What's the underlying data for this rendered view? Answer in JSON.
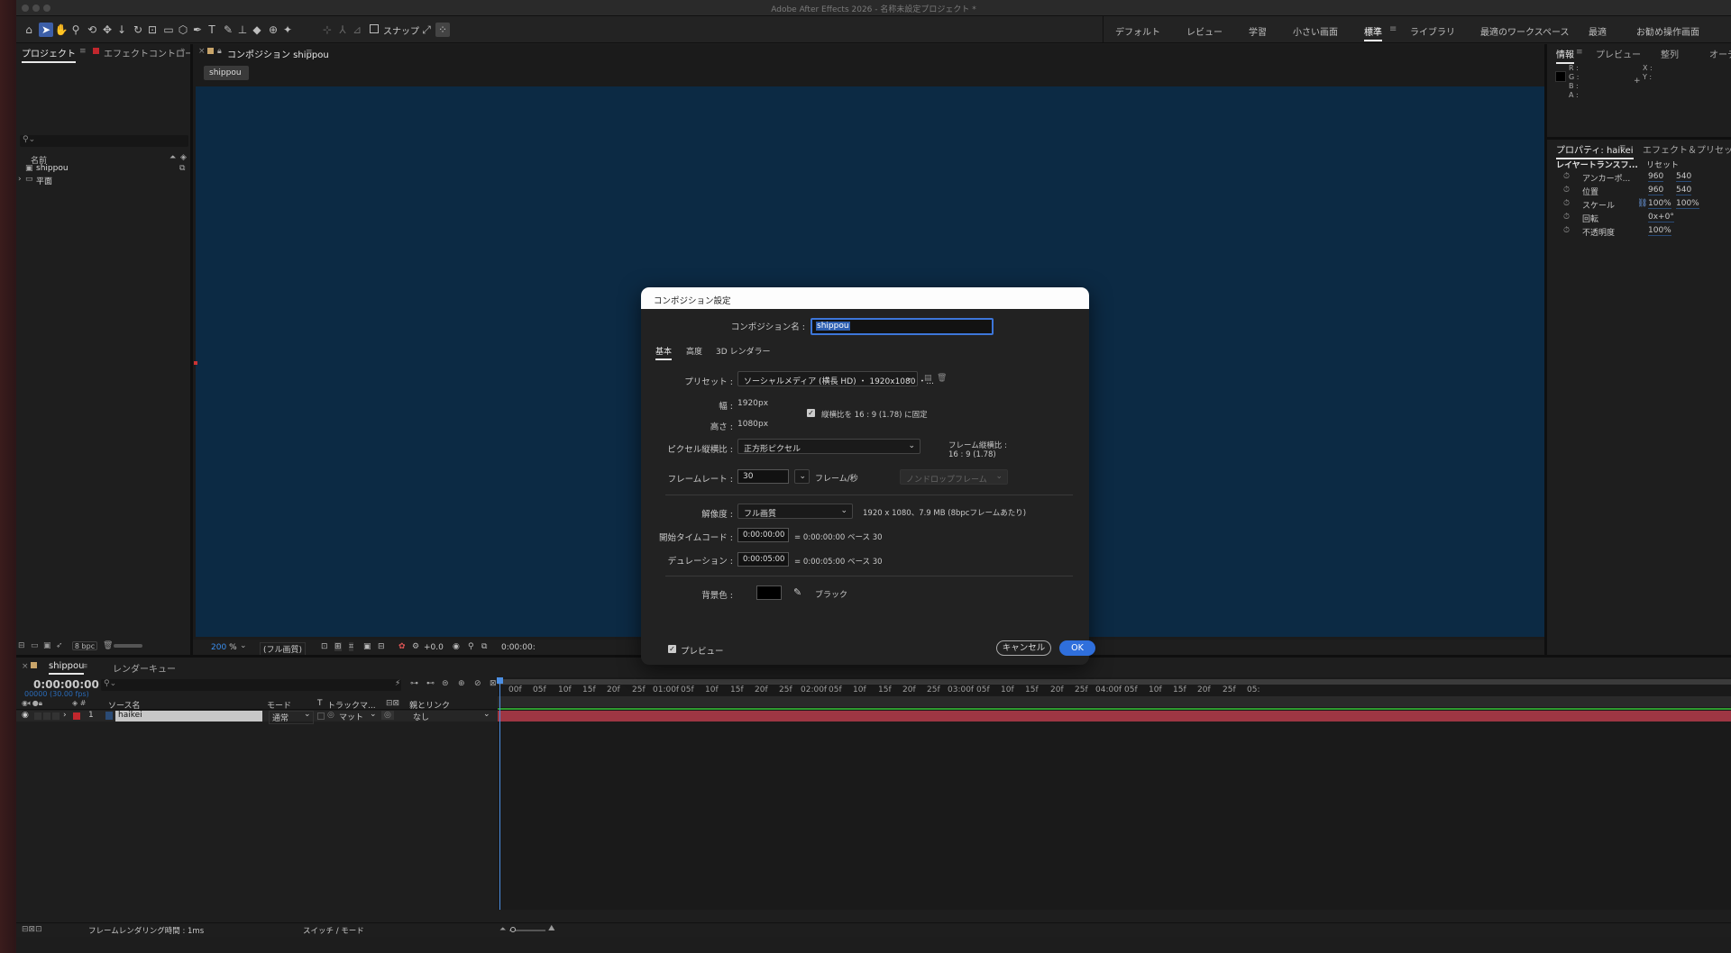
{
  "window": {
    "title": "Adobe After Effects 2026 - 名称未設定プロジェクト *"
  },
  "toolbar": {
    "snap_label": "スナップ"
  },
  "workspaces": [
    "デフォルト",
    "レビュー",
    "学習",
    "小さい画面",
    "標準",
    "ライブラリ",
    "最適のワークスペース",
    "最適",
    "お勧め操作画面"
  ],
  "workspace_active": "標準",
  "project_panel": {
    "tab_project": "プロジェクト",
    "tab_effect": "エフェクトコントロール I",
    "col_name": "名前",
    "items": [
      {
        "name": "shippou",
        "icon": "composition-icon"
      },
      {
        "name": "平面",
        "icon": "folder-icon"
      }
    ],
    "bpc": "8 bpc"
  },
  "comp_panel": {
    "tab": "コンポジション shippou",
    "chip": "shippou",
    "zoom": "200",
    "zoom_unit": "%",
    "quality": "(フル画質)",
    "exposure": "+0.0",
    "timecode": "0:00:00:",
    "canvas_color": "#0c2a44"
  },
  "info_panel": {
    "tab_info": "情報",
    "tab_preview": "プレビュー",
    "tab_align": "整列",
    "tab_audio": "オーデ",
    "r": "R :",
    "g": "G :",
    "b": "B :",
    "a": "A :",
    "x": "X :",
    "y": "Y :"
  },
  "properties_panel": {
    "tab": "プロパティ: haikei",
    "tab2": "エフェクト＆プリセット",
    "section": "レイヤートランスフ...",
    "reset": "リセット",
    "rows": [
      {
        "name": "アンカーポ...",
        "v1": "960",
        "v2": "540"
      },
      {
        "name": "位置",
        "v1": "960",
        "v2": "540"
      },
      {
        "name": "スケール",
        "v1": "100%",
        "v2": "100%"
      },
      {
        "name": "回転",
        "v1": "0x+0°",
        "v2": ""
      },
      {
        "name": "不透明度",
        "v1": "100%",
        "v2": ""
      }
    ]
  },
  "dialog": {
    "title": "コンポジション設定",
    "name_label": "コンポジション名 :",
    "name_value": "shippou",
    "tabs": [
      "基本",
      "高度",
      "3D レンダラー"
    ],
    "preset_label": "プリセット :",
    "preset_value": "ソーシャルメディア (横長 HD) ・ 1920x1080 ・...",
    "width_label": "幅 :",
    "width_value": "1920",
    "width_unit": "px",
    "height_label": "高さ :",
    "height_value": "1080",
    "height_unit": "px",
    "lock_label": "縦横比を 16 : 9 (1.78) に固定",
    "pixel_label": "ピクセル縦横比 :",
    "pixel_value": "正方形ピクセル",
    "frame_aspect_label": "フレーム縦横比 :",
    "frame_aspect_value": "16 : 9 (1.78)",
    "fps_label": "フレームレート :",
    "fps_value": "30",
    "fps_unit": "フレーム/秒",
    "dropframe": "ノンドロップフレーム",
    "resolution_label": "解像度 :",
    "resolution_value": "フル画質",
    "resolution_info": "1920 x 1080、7.9 MB (8bpcフレームあたり)",
    "start_label": "開始タイムコード :",
    "start_value": "0:00:00:00",
    "start_info": "= 0:00:00:00  ベース 30",
    "duration_label": "デュレーション :",
    "duration_value": "0:00:05:00",
    "duration_info": "= 0:00:05:00  ベース 30",
    "bg_label": "背景色 :",
    "bg_name": "ブラック",
    "preview_label": "プレビュー",
    "cancel": "キャンセル",
    "ok": "OK"
  },
  "timeline": {
    "tab": "shippou",
    "tab_render": "レンダーキュー",
    "timecode": "0:00:00:00",
    "frames": "00000 (30.00 fps)",
    "col_source": "ソース名",
    "col_mode": "モード",
    "col_t": "T",
    "col_track": "トラックマ...",
    "col_parent": "親とリンク",
    "layer": {
      "num": "1",
      "name": "haikei",
      "mode": "通常",
      "matte": "マット",
      "parent": "なし"
    },
    "ticks": [
      "00f",
      "05f",
      "10f",
      "15f",
      "20f",
      "25f",
      "01:00f",
      "05f",
      "10f",
      "15f",
      "20f",
      "25f",
      "02:00f",
      "05f",
      "10f",
      "15f",
      "20f",
      "25f",
      "03:00f",
      "05f",
      "10f",
      "15f",
      "20f",
      "25f",
      "04:00f",
      "05f",
      "10f",
      "15f",
      "20f",
      "25f",
      "05:"
    ],
    "footer_render": "フレームレンダリング時間 : 1ms",
    "footer_switch": "スイッチ / モード"
  }
}
